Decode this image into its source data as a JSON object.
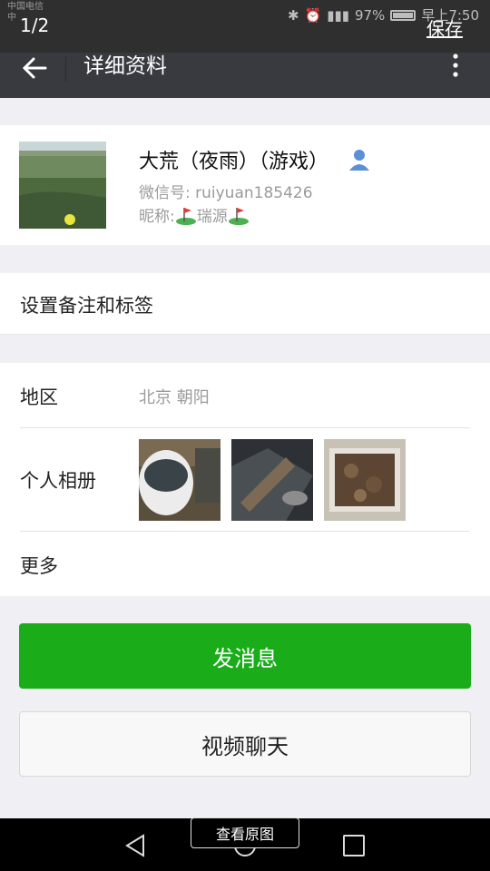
{
  "status_bar": {
    "carrier_top": "中国电信",
    "carrier_bottom": "中",
    "battery_percent": "97%",
    "time": "早上7:50"
  },
  "viewer": {
    "page_counter": "1/2",
    "save_label": "保存",
    "view_original_label": "查看原图"
  },
  "app_bar": {
    "title": "详细资料"
  },
  "profile": {
    "name": "大荒（夜雨）（游戏）",
    "wechat_id": "微信号: ruiyuan185426",
    "nickname_prefix": "昵称: ",
    "nickname": "瑞源"
  },
  "rows": {
    "remarks_label": "设置备注和标签",
    "region_label": "地区",
    "region_value": "北京  朝阳",
    "album_label": "个人相册",
    "more_label": "更多"
  },
  "buttons": {
    "send_message": "发消息",
    "video_chat": "视频聊天"
  },
  "colors": {
    "primary_green": "#1aad19",
    "app_bar_bg": "#393a3f",
    "background": "#efeff4"
  }
}
